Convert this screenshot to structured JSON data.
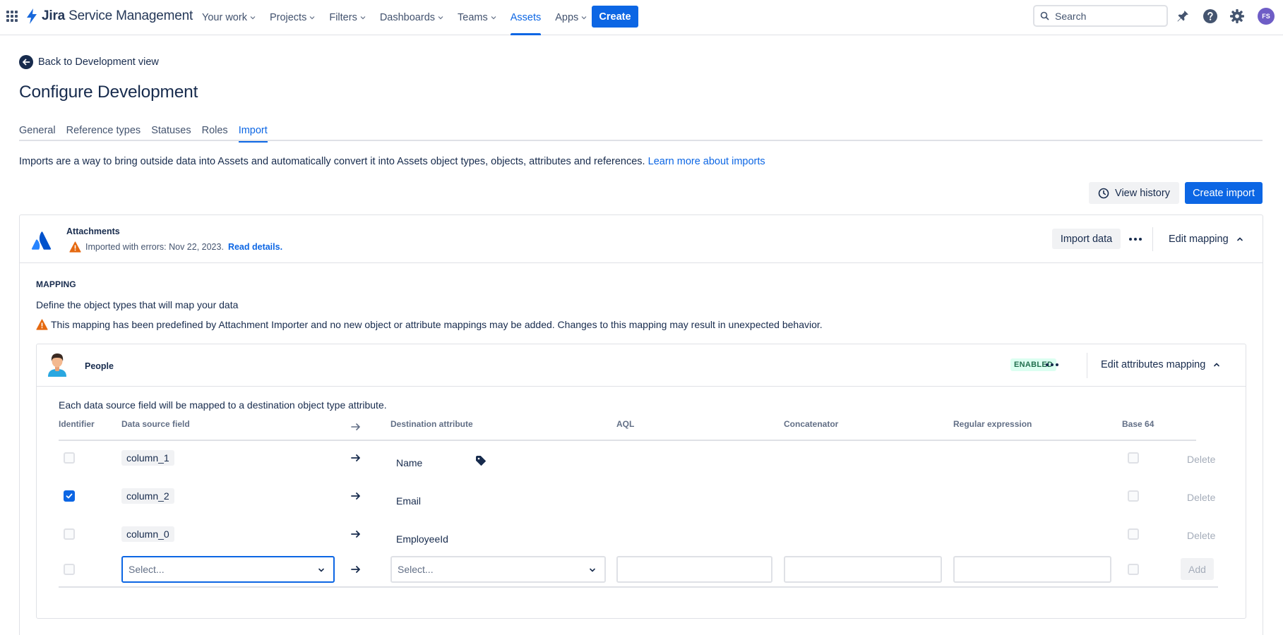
{
  "nav": {
    "brand": "Jira Service Management",
    "items": [
      {
        "label": "Your work",
        "dropdown": true
      },
      {
        "label": "Projects",
        "dropdown": true
      },
      {
        "label": "Filters",
        "dropdown": true
      },
      {
        "label": "Dashboards",
        "dropdown": true
      },
      {
        "label": "Teams",
        "dropdown": true
      },
      {
        "label": "Assets",
        "dropdown": false,
        "active": true
      },
      {
        "label": "Apps",
        "dropdown": true
      }
    ],
    "create_label": "Create",
    "search_placeholder": "Search",
    "avatar_initials": "FS",
    "accent_color": "#0c66e4"
  },
  "header": {
    "back_label": "Back to Development view",
    "title": "Configure Development"
  },
  "tabs": [
    {
      "label": "General"
    },
    {
      "label": "Reference types"
    },
    {
      "label": "Statuses"
    },
    {
      "label": "Roles"
    },
    {
      "label": "Import",
      "active": true
    }
  ],
  "intro": {
    "text": "Imports are a way to bring outside data into Assets and automatically convert it into Assets object types, objects, attributes and references.",
    "link": "Learn more about imports"
  },
  "actions": {
    "view_history": "View history",
    "create_import": "Create import"
  },
  "import_card": {
    "name": "Attachments",
    "status_text": "Imported with errors: Nov 22, 2023.",
    "status_link": "Read details.",
    "import_data": "Import data",
    "edit_mapping": "Edit mapping",
    "mapping_label": "MAPPING",
    "mapping_desc": "Define the object types that will map your data",
    "mapping_warning": "This mapping has been predefined by Attachment Importer and no new object or attribute mappings may be added. Changes to this mapping may result in unexpected behavior."
  },
  "object_type": {
    "name": "People",
    "status": "ENABLED",
    "edit_attrs": "Edit attributes mapping",
    "intro": "Each data source field will be mapped to a destination object type attribute.",
    "columns": {
      "identifier": "Identifier",
      "source": "Data source field",
      "destination": "Destination attribute",
      "aql": "AQL",
      "concatenator": "Concatenator",
      "regex": "Regular expression",
      "base64": "Base 64"
    },
    "rows": [
      {
        "identifier": false,
        "source": "column_1",
        "destination": "Name",
        "has_tag": true,
        "delete": "Delete"
      },
      {
        "identifier": true,
        "source": "column_2",
        "destination": "Email",
        "has_tag": false,
        "delete": "Delete"
      },
      {
        "identifier": false,
        "source": "column_0",
        "destination": "EmployeeId",
        "has_tag": false,
        "delete": "Delete"
      }
    ],
    "new_row": {
      "source_placeholder": "Select...",
      "destination_placeholder": "Select...",
      "add": "Add"
    }
  }
}
